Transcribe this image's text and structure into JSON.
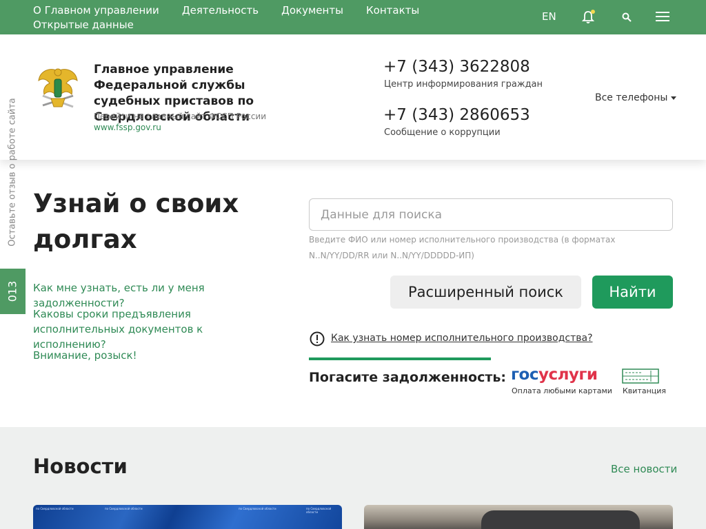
{
  "topnav": {
    "items": [
      "О Главном управлении",
      "Деятельность",
      "Документы",
      "Контакты",
      "Открытые данные"
    ],
    "lang": "EN",
    "icons": [
      "bell-icon",
      "search-icon",
      "menu-icon"
    ],
    "accent": "#4f9a63"
  },
  "header": {
    "org_name": "Главное управление Федеральной службы судебных приставов по Свердловской области",
    "sub": "Перейти на главный сайт ФССП России",
    "link": "www.fssp.gov.ru",
    "phones": [
      {
        "number": "+7 (343) 3622808",
        "caption": "Центр информирования граждан"
      },
      {
        "number": "+7 (343) 2860653",
        "caption": "Сообщение о коррупции"
      }
    ],
    "all_phones": "Все телефоны"
  },
  "side": {
    "feedback": "Оставьте отзыв о работе сайта",
    "badge": "013"
  },
  "main": {
    "title": "Узнай о своих долгах",
    "faq": [
      "Как мне узнать, есть ли у меня задолженности?",
      "Каковы сроки предъявления исполнительных документов к исполнению?",
      "Внимание, розыск!"
    ],
    "search_placeholder": "Данные для поиска",
    "hint": "Введите ФИО или номер исполнительного производства (в форматах N..N/YY/DD/RR или N..N/YY/DDDDD-ИП)",
    "advanced_label": "Расширенный поиск",
    "find_label": "Найти",
    "help": "Как узнать номер исполнительного производства?",
    "pay": {
      "label": "Погасите задолженность:",
      "gos_blue": "гос",
      "gos_red": "услуги",
      "gos_caption": "Оплата любыми картами",
      "receipt_caption": "Квитанция"
    },
    "button_color": "#1f9a5c"
  },
  "news": {
    "title": "Новости",
    "all": "Все новости",
    "card_caption": "по Свердловской области"
  }
}
